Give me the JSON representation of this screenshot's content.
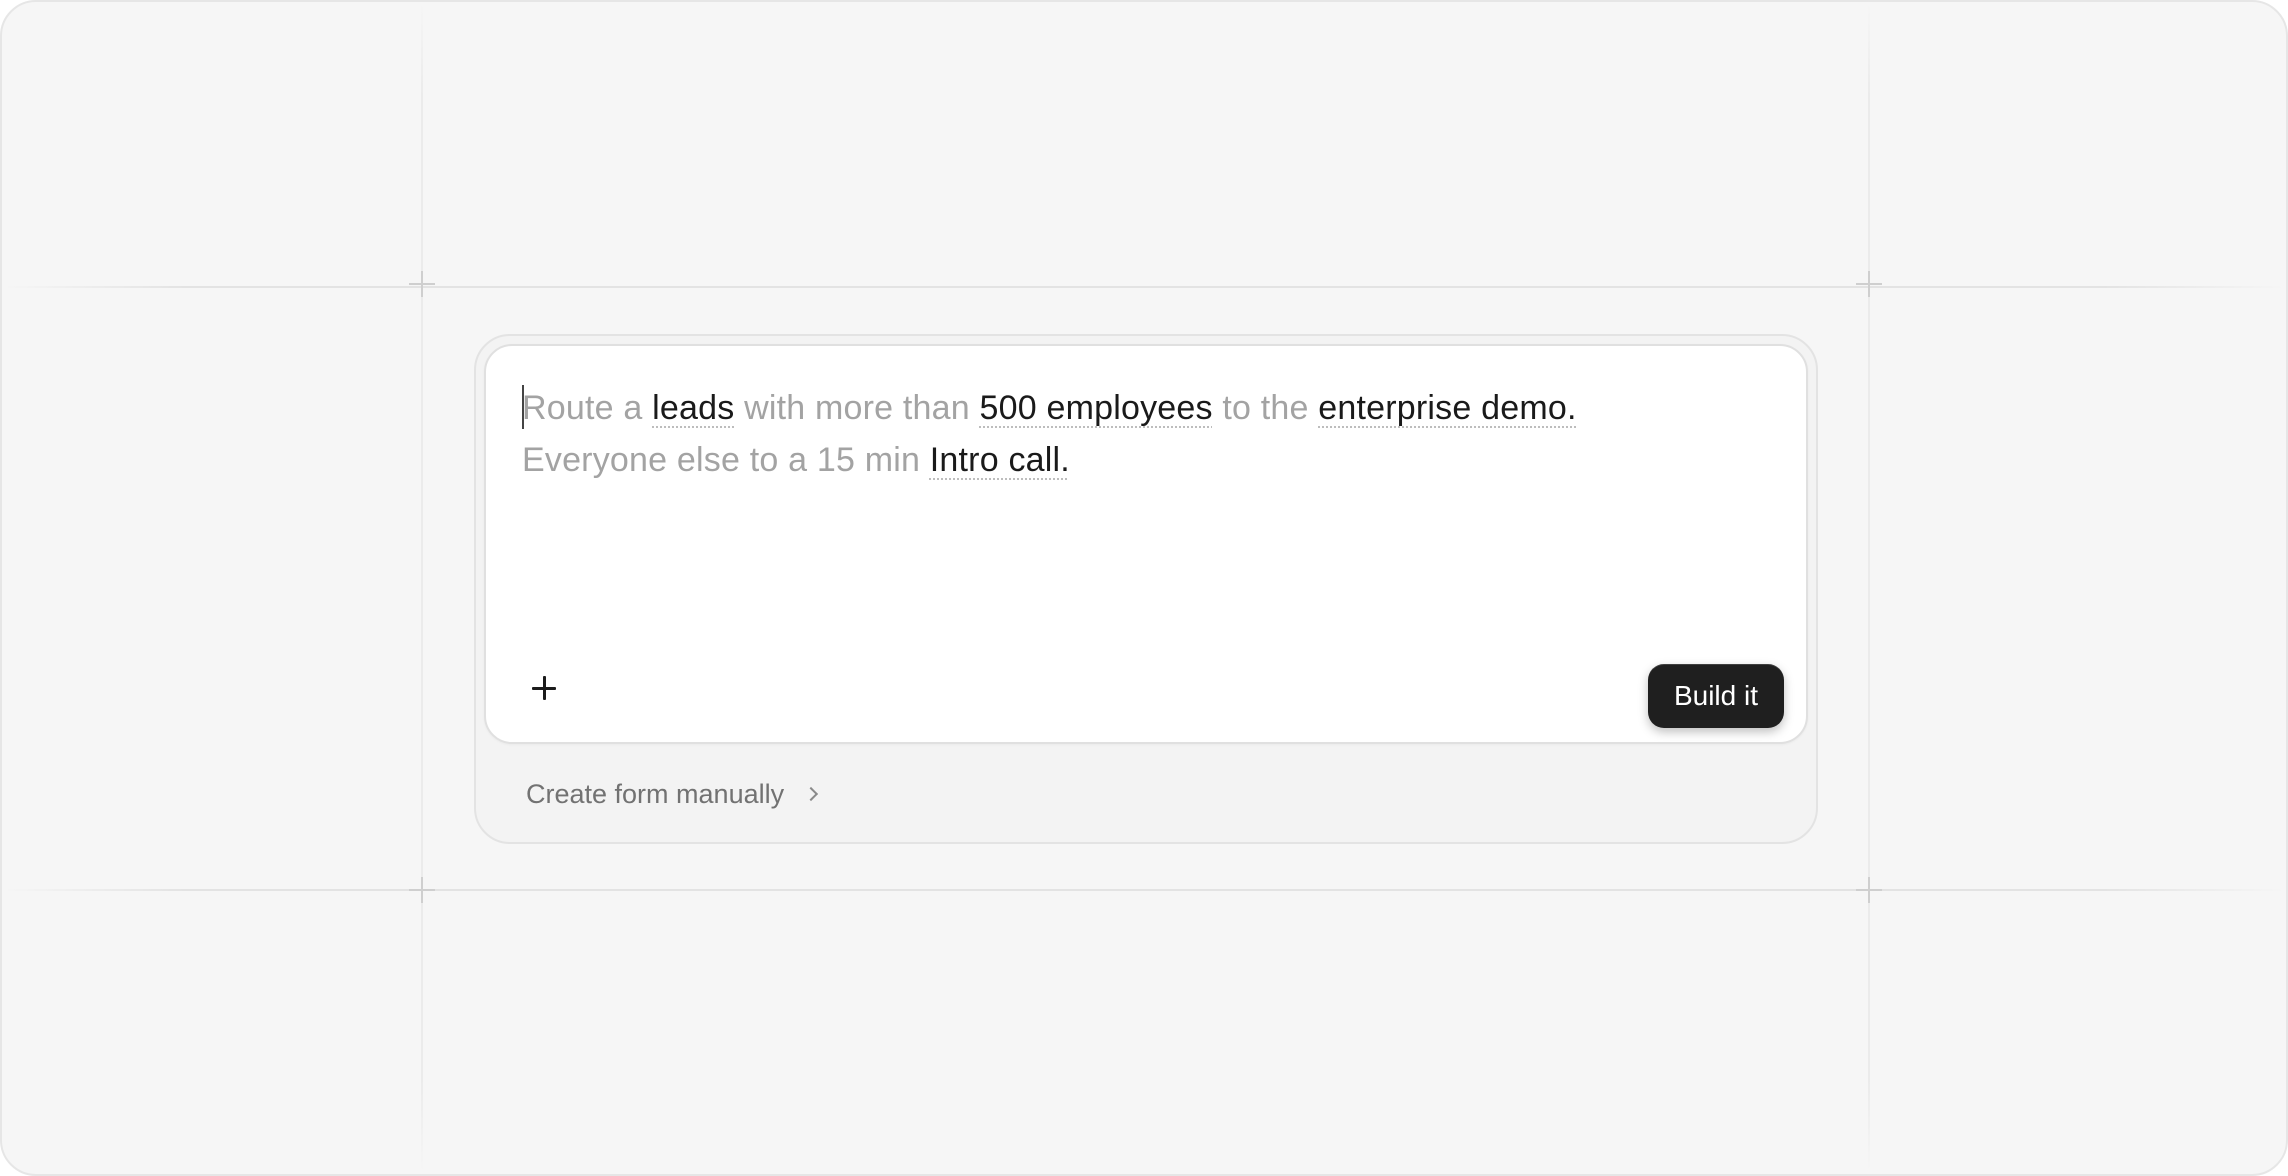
{
  "prompt": {
    "t1": "Route a ",
    "leads": "leads",
    "t2": " with more than ",
    "employees": "500 employees",
    "t3": " to the ",
    "demo": "enterprise demo.",
    "t4": "Everyone else to a 15 min ",
    "intro": "Intro call."
  },
  "actions": {
    "add_icon": "plus-icon",
    "build_label": "Build it",
    "manual_label": "Create form manually",
    "manual_icon": "chevron-right-icon"
  },
  "colors": {
    "background": "#f6f6f6",
    "card": "#ffffff",
    "placeholder_text": "#a3a3a3",
    "highlight_text": "#1a1a1a",
    "button_bg": "#1f1f1f"
  }
}
